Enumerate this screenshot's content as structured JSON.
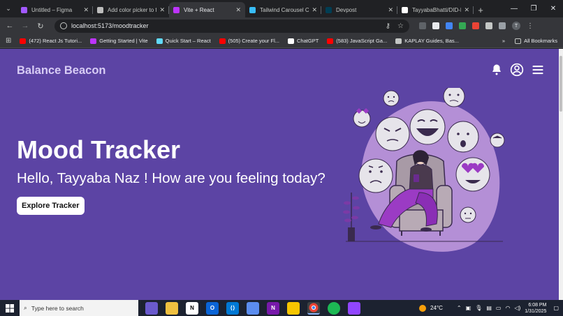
{
  "browser": {
    "tabs": [
      {
        "title": "Untitled – Figma",
        "color": "#a259ff",
        "active": false
      },
      {
        "title": "Add color picker to fo",
        "color": "#bdbdbd",
        "active": false
      },
      {
        "title": "Vite + React",
        "color": "#bd34fe",
        "active": true
      },
      {
        "title": "Tailwind Carousel Co",
        "color": "#38bdf8",
        "active": false
      },
      {
        "title": "Devpost",
        "color": "#003e54",
        "active": false
      },
      {
        "title": "TayyabaBhatti/DID-Po",
        "color": "#ffffff",
        "active": false
      }
    ],
    "new_tab": "+",
    "url": "localhost:5173/moodtracker",
    "profile_initial": "T",
    "bookmarks": [
      {
        "label": "(472) React Js Tutori...",
        "color": "#ff0000"
      },
      {
        "label": "Getting Started | Vite",
        "color": "#bd34fe"
      },
      {
        "label": "Quick Start – React",
        "color": "#61dafb"
      },
      {
        "label": "(505) Create your Fl...",
        "color": "#ff0000"
      },
      {
        "label": "ChatGPT",
        "color": "#ffffff"
      },
      {
        "label": "(583) JavaScript Ga...",
        "color": "#ff0000"
      },
      {
        "label": "KAPLAY Guides, Bas...",
        "color": "#c4c7c5"
      }
    ],
    "all_bookmarks": "All Bookmarks"
  },
  "page": {
    "brand": "Balance Beacon",
    "title": "Mood Tracker",
    "greeting": "Hello, Tayyaba Naz ! How are you feeling today?",
    "cta_label": "Explore Tracker",
    "icons": [
      "bell-icon",
      "user-circle-icon",
      "menu-icon"
    ]
  },
  "taskbar": {
    "search_placeholder": "Type here to search",
    "weather": "24°C",
    "time": "6:08 PM",
    "date": "1/31/2025"
  },
  "colors": {
    "page_bg": "#5c44a4",
    "brand": "#d8cdf5",
    "blob": "#b48fd6"
  }
}
